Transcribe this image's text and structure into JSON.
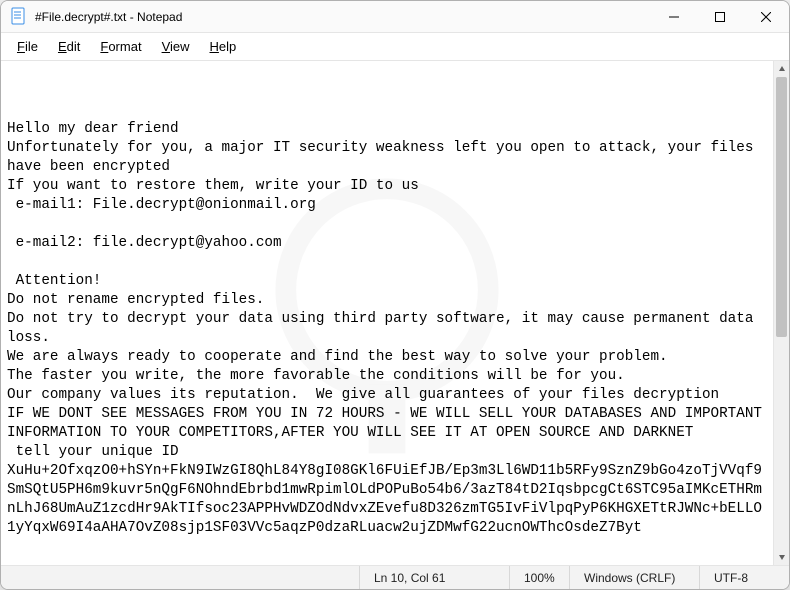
{
  "window": {
    "title": "#File.decrypt#.txt - Notepad"
  },
  "menubar": [
    "File",
    "Edit",
    "Format",
    "View",
    "Help"
  ],
  "body_text": "Hello my dear friend\nUnfortunately for you, a major IT security weakness left you open to attack, your files have been encrypted\nIf you want to restore them, write your ID to us\n e-mail1: File.decrypt@onionmail.org\n\n e-mail2: file.decrypt@yahoo.com\n\n Attention!\nDo not rename encrypted files.\nDo not try to decrypt your data using third party software, it may cause permanent data loss.\nWe are always ready to cooperate and find the best way to solve your problem.\nThe faster you write, the more favorable the conditions will be for you.\nOur company values its reputation.  We give all guarantees of your files decryption\nIF WE DONT SEE MESSAGES FROM YOU IN 72 HOURS - WE WILL SELL YOUR DATABASES AND IMPORTANT INFORMATION TO YOUR COMPETITORS,AFTER YOU WILL SEE IT AT OPEN SOURCE AND DARKNET\n tell your unique ID\nXuHu+2OfxqzO0+hSYn+FkN9IWzGI8QhL84Y8gI08GKl6FUiEfJB/Ep3m3Ll6WD11b5RFy9SznZ9bGo4zoTjVVqf9SmSQtU5PH6m9kuvr5nQgF6NOhndEbrbd1mwRpimlOLdPOPuBo54b6/3azT84tD2IqsbpcgCt6STC95aIMKcETHRmnLhJ68UmAuZ1zcdHr9AkTIfsoc23APPHvWDZOdNdvxZEvefu8D326zmTG5IvFiVlpqPyP6KHGXETtRJWNc+bELLO1yYqxW69I4aAHA7OvZ08sjp1SF03VVc5aqzP0dzaRLuacw2ujZDMwfG22ucnOWThcOsdeZ7Byt",
  "status": {
    "position": "Ln 10, Col 61",
    "zoom": "100%",
    "eol": "Windows (CRLF)",
    "encoding": "UTF-8"
  }
}
